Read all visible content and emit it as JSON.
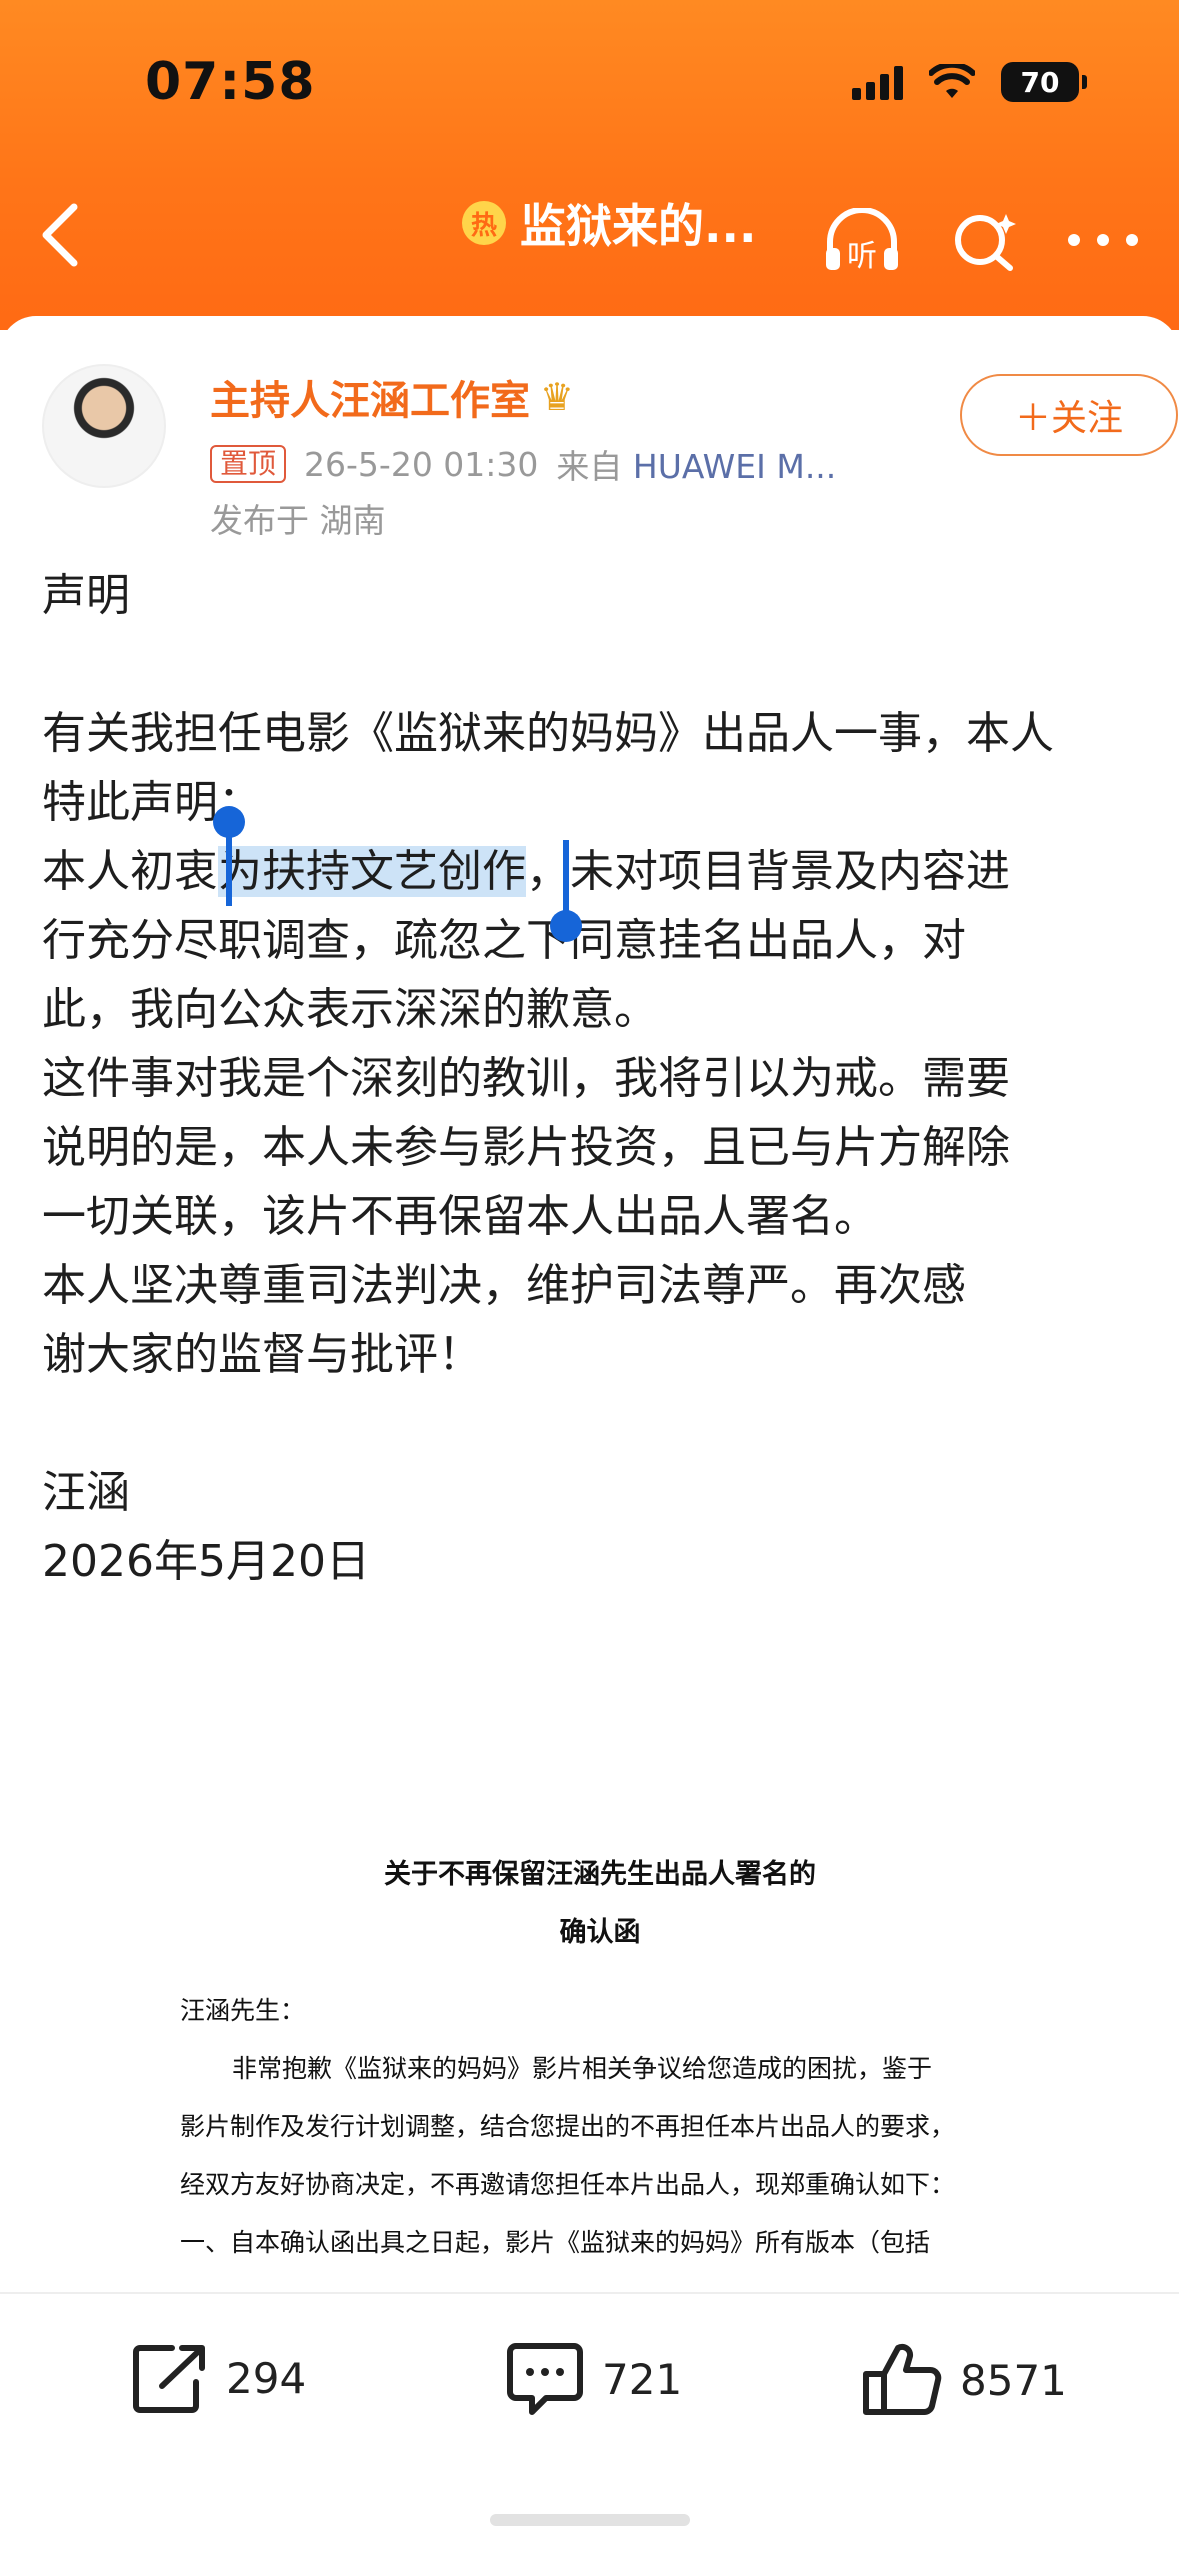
{
  "status_bar": {
    "time": "07:58",
    "battery": "70"
  },
  "nav": {
    "hot_badge": "热",
    "title": "监狱来的...",
    "listen": "听"
  },
  "post": {
    "author": "主持人汪涵工作室",
    "pin": "置顶",
    "timestamp": "26-5-20 01:30",
    "source_prefix": "来自",
    "source": "HUAWEI M...",
    "location": "发布于 湖南",
    "follow": "＋关注",
    "lines": [
      "声明",
      "",
      "有关我担任电影《监狱来的妈妈》出品人一事，本人",
      "特此声明：",
      "本人初衷",
      "为扶持文艺创作",
      "，未对项目背景及内容进",
      "行充分尽职调查，疏忽之下同意挂名出品人，对",
      "此，我向公众表示深深的歉意。",
      "这件事对我是个深刻的教训，我将引以为戒。需要",
      "说明的是，本人未参与影片投资，且已与片方解除",
      "一切关联，该片不再保留本人出品人署名。",
      "本人坚决尊重司法判决，维护司法尊严。再次感",
      "谢大家的监督与批评！",
      "",
      "汪涵",
      "2026年5月20日"
    ]
  },
  "letter": {
    "title_1": "关于不再保留汪涵先生出品人署名的",
    "title_2": "确认函",
    "greeting": "汪涵先生：",
    "body": [
      "非常抱歉《监狱来的妈妈》影片相关争议给您造成的困扰，鉴于",
      "影片制作及发行计划调整，结合您提出的不再担任本片出品人的要求，",
      "经双方友好协商决定，不再邀请您担任本片出品人，现郑重确认如下：",
      "一、自本确认函出具之日起，影片《监狱来的妈妈》所有版本（包括"
    ]
  },
  "actions": {
    "share": "294",
    "comment": "721",
    "like": "8571"
  },
  "colors": {
    "header": "#ff7518",
    "author": "#f26a1b",
    "selection": "#1665d8"
  }
}
